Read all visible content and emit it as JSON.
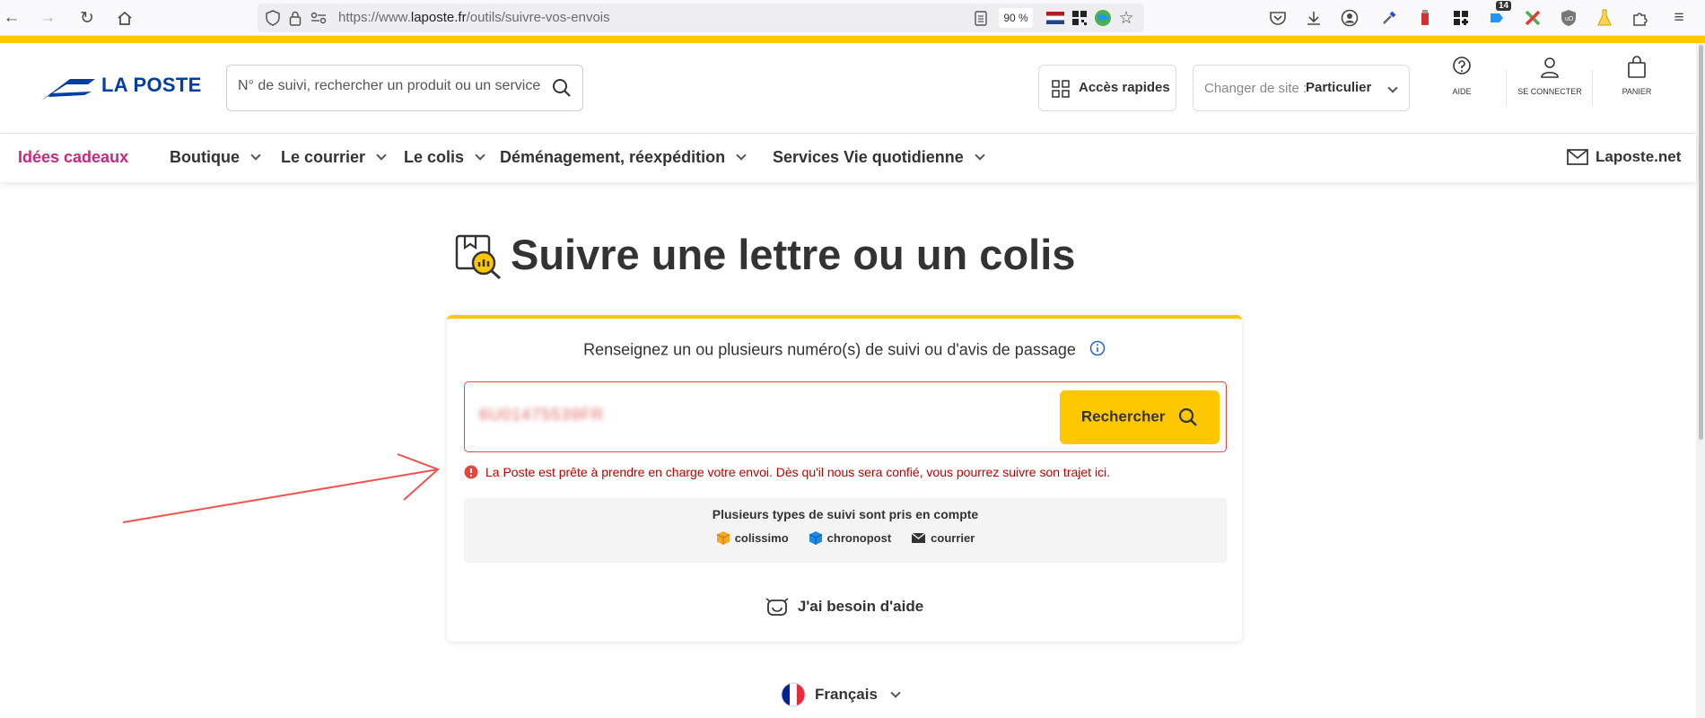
{
  "browser": {
    "url_prefix": "https://www.",
    "url_domain": "laposte.fr",
    "url_path": "/outils/suivre-vos-envois",
    "zoom": "90 %",
    "ext_badge": "14"
  },
  "header": {
    "logo": "LA POSTE",
    "search_placeholder": "N° de suivi, rechercher un produit ou un service ...",
    "acces_rapides": "Accès rapides",
    "site_label": "Changer de site :",
    "site_value": "Particulier",
    "aide": "AIDE",
    "connect": "SE CONNECTER",
    "panier": "PANIER"
  },
  "nav": {
    "items": [
      "Idées cadeaux",
      "Boutique",
      "Le courrier",
      "Le colis",
      "Déménagement, réexpédition",
      "Services Vie quotidienne"
    ],
    "right": "Laposte.net"
  },
  "main": {
    "title": "Suivre une lettre ou un colis",
    "instructions": "Renseignez un ou plusieurs numéro(s) de suivi ou d'avis de passage",
    "tracking_value": "6U01475539FR",
    "search_button": "Rechercher",
    "error": "La Poste est prête à prendre en charge votre envoi. Dès qu'il nous sera confié, vous pourrez suivre son trajet ici.",
    "types_title": "Plusieurs types de suivi sont pris en compte",
    "types": [
      "colissimo",
      "chronopost",
      "courrier"
    ],
    "help": "J'ai besoin d'aide",
    "language": "Français"
  },
  "colors": {
    "accent": "#ffc700",
    "brand": "#003da5",
    "error": "#c00000",
    "promo": "#c8287f"
  }
}
